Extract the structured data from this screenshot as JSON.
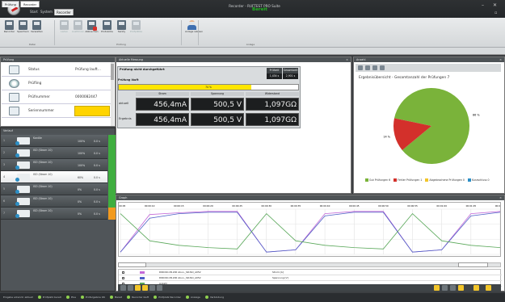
{
  "window": {
    "title": "Recorder - RUFTEST PRO Suite",
    "menu_tabs": [
      "Start",
      "System",
      "Recorder"
    ]
  },
  "ribbon": {
    "buttons": [
      {
        "label": "Recorder",
        "icon": "recorder-icon",
        "enabled": true
      },
      {
        "label": "Speichern",
        "icon": "save-icon",
        "enabled": true
      },
      {
        "label": "Verwalten",
        "icon": "manage-icon",
        "enabled": true
      },
      {
        "label": "Laden",
        "icon": "load-icon",
        "enabled": false
      },
      {
        "label": "Ausführen",
        "icon": "run-icon",
        "enabled": false
      },
      {
        "label": "Abbrechen",
        "icon": "cancel-icon",
        "enabled": true
      },
      {
        "label": "Protokolle",
        "icon": "protocol-icon",
        "enabled": true
      },
      {
        "label": "Sanity",
        "icon": "sanity-icon",
        "enabled": true
      },
      {
        "label": "Prüfplätze",
        "icon": "stations-icon",
        "enabled": false
      },
      {
        "label": "Anlage wählen",
        "icon": "user-icon",
        "enabled": true
      }
    ],
    "groups": [
      "Datei",
      "Prüfung",
      "Anlage"
    ],
    "live_status": "Bereit"
  },
  "doc_tabs": [
    "Prüfung",
    "Recorder"
  ],
  "panels": {
    "left_top": "Prüfung",
    "left_bottom": "Verlauf",
    "middle": "Aktuelle Messung",
    "right": "Anzahl",
    "graph": "Graph"
  },
  "test_info": [
    {
      "label": "Status",
      "value": "Prüfung lauft..."
    },
    {
      "label": "Prüfling",
      "value": ""
    },
    {
      "label": "Prüfnummer",
      "value": "0000082447"
    },
    {
      "label": "Seriennummer",
      "value": ""
    }
  ],
  "channels": [
    {
      "num": "1",
      "name": "Kanäle",
      "pct": "100%",
      "time": "0.0 s",
      "status": "#3fae3f"
    },
    {
      "num": "2",
      "name": "ISO (Strom 10)",
      "pct": "100%",
      "time": "0.0 s",
      "status": "#3fae3f"
    },
    {
      "num": "3",
      "name": "ISO (Strom 10)",
      "pct": "100%",
      "time": "0.0 s",
      "status": "#3fae3f"
    },
    {
      "num": "4",
      "name": "ISO (Strom 10)",
      "pct": "60%",
      "time": "0.0 s",
      "status": "#3fae3f"
    },
    {
      "num": "5",
      "name": "ISO (Strom 10)",
      "pct": "0%",
      "time": "0.0 s",
      "status": "#3fae3f"
    },
    {
      "num": "6",
      "name": "ISO (Strom 10)",
      "pct": "0%",
      "time": "0.0 s",
      "status": "#3fae3f"
    },
    {
      "num": "7",
      "name": "ISO (Strom 10)",
      "pct": "0%",
      "time": "0.0 s",
      "status": "#f29a1f"
    }
  ],
  "measurement": {
    "title": "Prüfung nicht durchgeführt",
    "control_labels": [
      "Prüfzeit",
      "Gesamtzeit"
    ],
    "control_values": [
      "1,434 s",
      "2,901 s"
    ],
    "testing_label": "Prüfung läuft",
    "progress_percent": 74,
    "progress_label": "74 %",
    "columns": [
      "Strom",
      "Spannung",
      "Widerstand"
    ],
    "rows": [
      {
        "label": "aktuell",
        "values": [
          "456,4mA",
          "500,5 V",
          "1,097GΩ"
        ]
      },
      {
        "label": "Ergebnis",
        "values": [
          "456,4mA",
          "500,5 V",
          "1,097GΩ"
        ]
      }
    ]
  },
  "pie": {
    "title": "Ergebnisübersicht - Gesamtanzahl der Prüfungen 7",
    "legend": [
      {
        "label": "Gut Prüfungen 6",
        "color": "#7ab33a"
      },
      {
        "label": "Fehler Prüfungen 1",
        "color": "#d3302b"
      },
      {
        "label": "Abgebrochene Prüfungen 0",
        "color": "#f2c52a"
      },
      {
        "label": "Kurzschluss 0",
        "color": "#2c8fc6"
      }
    ]
  },
  "chart_data": [
    {
      "type": "pie",
      "title": "Ergebnisübersicht - Gesamtanzahl der Prüfungen 7",
      "categories": [
        "Gut Prüfungen",
        "Fehler Prüfungen",
        "Abgebrochene Prüfungen",
        "Kurzschluss"
      ],
      "values": [
        6,
        1,
        0,
        0
      ],
      "data_labels": [
        "86 %",
        "14 %"
      ],
      "colors": [
        "#7ab33a",
        "#d3302b",
        "#f2c52a",
        "#2c8fc6"
      ],
      "legend_position": "bottom"
    },
    {
      "type": "line",
      "x_ticks": [
        "00:00:05",
        "00:00:10",
        "00:00:15",
        "00:00:20",
        "00:00:25",
        "00:00:30",
        "00:00:35",
        "00:00:40",
        "00:00:45",
        "00:00:50",
        "00:00:55",
        "00:01:00",
        "00:01:05",
        "00:01:10"
      ],
      "series": [
        {
          "name": "Strom [A]",
          "color": "#c46ad8",
          "values": [
            0.05,
            0.88,
            0.92,
            0.95,
            0.95,
            0.05,
            0.1,
            0.9,
            0.95,
            0.95,
            0.05,
            0.1,
            0.9,
            0.95
          ]
        },
        {
          "name": "Spannung [V]",
          "color": "#4d5fc6",
          "values": [
            0.05,
            0.8,
            0.9,
            0.93,
            0.93,
            0.05,
            0.1,
            0.85,
            0.93,
            0.93,
            0.05,
            0.1,
            0.85,
            0.93
          ]
        },
        {
          "name": "",
          "color": "#5aa85a",
          "values": [
            0.9,
            0.3,
            0.2,
            0.15,
            0.12,
            0.9,
            0.3,
            0.2,
            0.15,
            0.12,
            0.9,
            0.3,
            0.2,
            0.15
          ]
        }
      ],
      "grid": true
    }
  ],
  "graph_table": [
    {
      "name": "DIRC09-CB-200 Abun._SR.ISO_A052",
      "value": "Strom [A]"
    },
    {
      "name": "DIRC09-CB-200 Abun._SR.ISO_A052",
      "value": "Spannung [V]"
    },
    {
      "name": "Anzahl",
      "value": ""
    }
  ],
  "status_items": [
    "Eingabe erkannt: aktuell",
    "Prüfplatz bereit",
    "Plus",
    "Prüfergebnis OK",
    "Bereit",
    "Recorder läuft",
    "Prüfplatz Recorder",
    "Anzeige",
    "Verbindung"
  ]
}
